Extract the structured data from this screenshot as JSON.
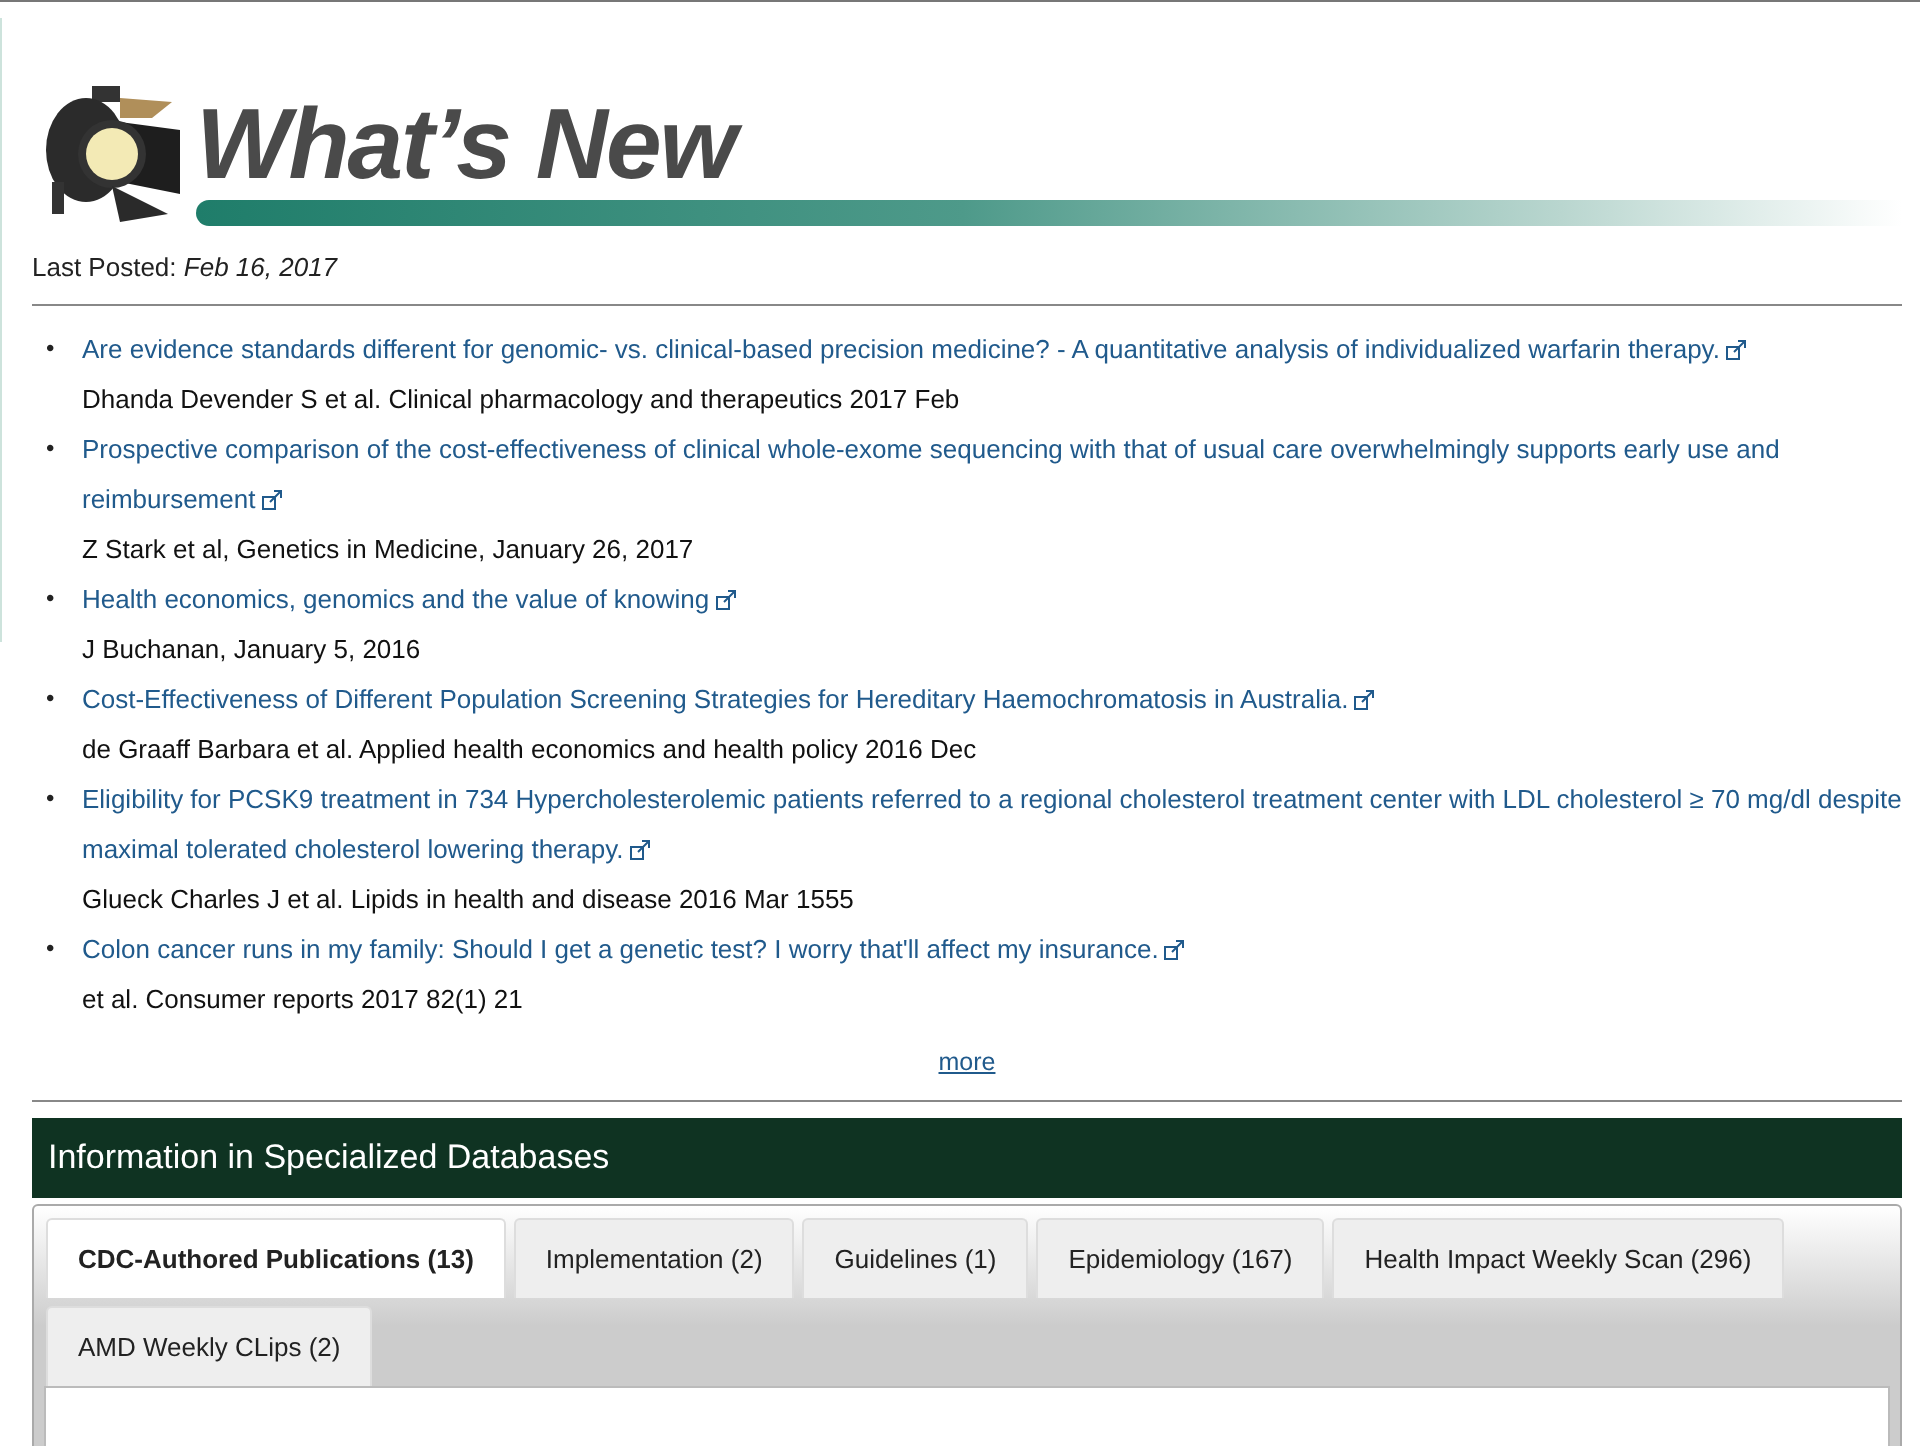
{
  "header": {
    "title": "What’s New",
    "last_posted_label": "Last Posted:",
    "last_posted_date": "Feb 16, 2017"
  },
  "bullet": "•",
  "articles": [
    {
      "title": "Are evidence standards different for genomic- vs. clinical-based precision medicine? - A quantitative analysis of individualized warfarin therapy.",
      "citation": "Dhanda Devender S et al. Clinical pharmacology and therapeutics 2017 Feb"
    },
    {
      "title": "Prospective comparison of the cost-effectiveness of clinical whole-exome sequencing with that of usual care overwhelmingly supports early use and reimbursement",
      "citation": "Z Stark et al, Genetics in Medicine, January 26, 2017"
    },
    {
      "title": "Health economics, genomics and the value of knowing",
      "citation": "J Buchanan, January 5, 2016"
    },
    {
      "title": "Cost-Effectiveness of Different Population Screening Strategies for Hereditary Haemochromatosis in Australia.",
      "citation": "de Graaff Barbara et al. Applied health economics and health policy 2016 Dec"
    },
    {
      "title": "Eligibility for PCSK9 treatment in 734 Hypercholesterolemic patients referred to a regional cholesterol treatment center with LDL cholesterol ≥ 70 mg/dl despite maximal tolerated cholesterol lowering therapy.",
      "citation": "Glueck Charles J et al. Lipids in health and disease 2016 Mar 1555"
    },
    {
      "title": "Colon cancer runs in my family: Should I get a genetic test? I worry that'll affect my insurance.",
      "citation": "et al. Consumer reports 2017 82(1) 21"
    }
  ],
  "more_link": "more",
  "databases": {
    "title": "Information in Specialized Databases",
    "tabs": [
      {
        "label": "CDC-Authored Publications (13)",
        "selected": true
      },
      {
        "label": "Implementation (2)",
        "selected": false
      },
      {
        "label": "Guidelines (1)",
        "selected": false
      },
      {
        "label": "Epidemiology (167)",
        "selected": false
      },
      {
        "label": "Health Impact Weekly Scan (296)",
        "selected": false
      },
      {
        "label": "AMD Weekly CLips (2)",
        "selected": false
      }
    ]
  }
}
